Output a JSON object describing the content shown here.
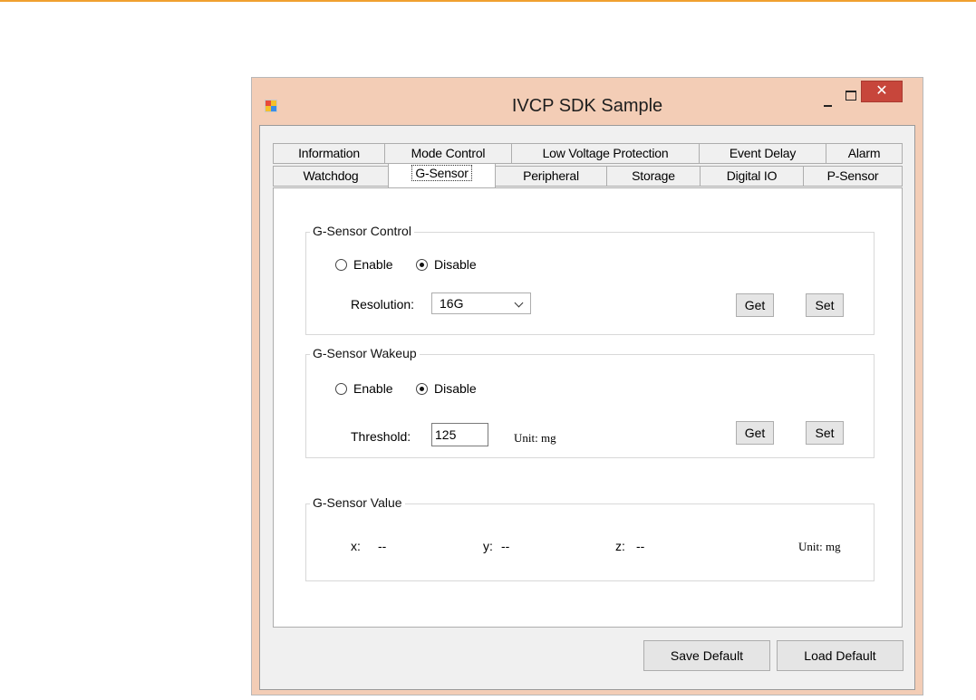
{
  "window": {
    "title": "IVCP SDK Sample",
    "close_glyph": "✕",
    "accent_color": "#f3cdb6",
    "close_color": "#c7463b"
  },
  "tabs": {
    "row1": [
      "Information",
      "Mode Control",
      "Low Voltage Protection",
      "Event Delay",
      "Alarm"
    ],
    "row2": [
      "Watchdog",
      "G-Sensor",
      "Peripheral",
      "Storage",
      "Digital IO",
      "P-Sensor"
    ],
    "active": "G-Sensor"
  },
  "control": {
    "title": "G-Sensor Control",
    "enable_label": "Enable",
    "disable_label": "Disable",
    "selected": "Disable",
    "resolution_label": "Resolution:",
    "resolution_value": "16G",
    "get_label": "Get",
    "set_label": "Set"
  },
  "wakeup": {
    "title": "G-Sensor Wakeup",
    "enable_label": "Enable",
    "disable_label": "Disable",
    "selected": "Disable",
    "threshold_label": "Threshold:",
    "threshold_value": "125",
    "unit_label": "Unit: mg",
    "get_label": "Get",
    "set_label": "Set"
  },
  "value": {
    "title": "G-Sensor Value",
    "x_label": "x:",
    "x_value": "--",
    "y_label": "y:",
    "y_value": "--",
    "z_label": "z:",
    "z_value": "--",
    "unit_label": "Unit: mg"
  },
  "footer": {
    "save_default_label": "Save Default",
    "load_default_label": "Load Default"
  },
  "icons": {
    "app": "app-icon",
    "minimize": "minimize-icon",
    "maximize": "maximize-icon",
    "close": "close-icon",
    "dropdown": "chevron-down-icon"
  }
}
